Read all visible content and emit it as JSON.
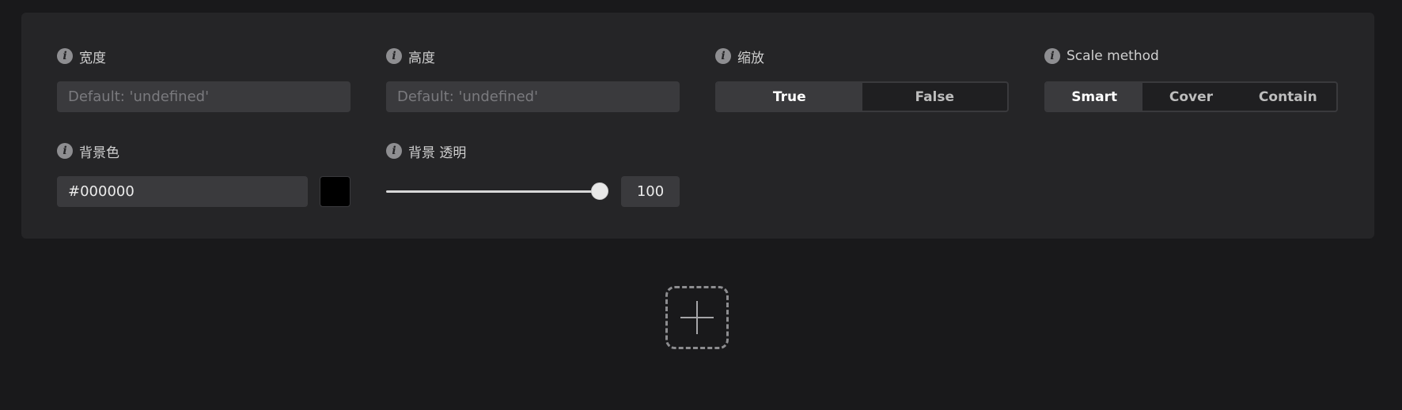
{
  "fields": {
    "width": {
      "label": "宽度",
      "placeholder": "Default: 'undefined'",
      "value": ""
    },
    "height": {
      "label": "高度",
      "placeholder": "Default: 'undefined'",
      "value": ""
    },
    "scale": {
      "label": "缩放",
      "options": [
        "True",
        "False"
      ],
      "selected": "True"
    },
    "scale_method": {
      "label": "Scale method",
      "options": [
        "Smart",
        "Cover",
        "Contain"
      ],
      "selected": "Smart"
    },
    "background_color": {
      "label": "背景色",
      "value": "#000000",
      "swatch_color": "#000000"
    },
    "background_opacity": {
      "label": "背景 透明",
      "value": "100",
      "level_percent": 100
    }
  },
  "icons": {
    "info": "info-icon",
    "add": "plus-icon"
  },
  "colors": {
    "page_background": "#19191b",
    "panel_background": "#252527",
    "input_background": "#3a3a3d"
  }
}
